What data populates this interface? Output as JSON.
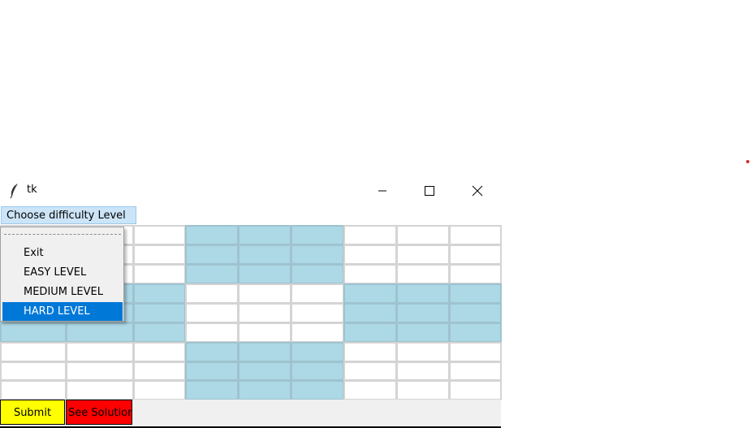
{
  "window": {
    "title": "tk",
    "controls": {
      "minimize": "minimize",
      "maximize": "maximize",
      "close": "close"
    }
  },
  "menubar": {
    "menu_label": "Choose difficulty Level"
  },
  "menu": {
    "items": [
      {
        "label": "Exit"
      },
      {
        "label": "EASY LEVEL"
      },
      {
        "label": "MEDIUM LEVEL"
      },
      {
        "label": "HARD LEVEL",
        "highlighted": true
      }
    ]
  },
  "buttons": {
    "submit": "Submit",
    "see_solution": "See Solution"
  },
  "colors": {
    "box_shade": "#add8e6",
    "cell_white": "#ffffff",
    "submit_bg": "#ffff00",
    "solution_bg": "#ff0000",
    "menu_highlight": "#0078d7",
    "menubutton_bg": "#cce4f7"
  }
}
